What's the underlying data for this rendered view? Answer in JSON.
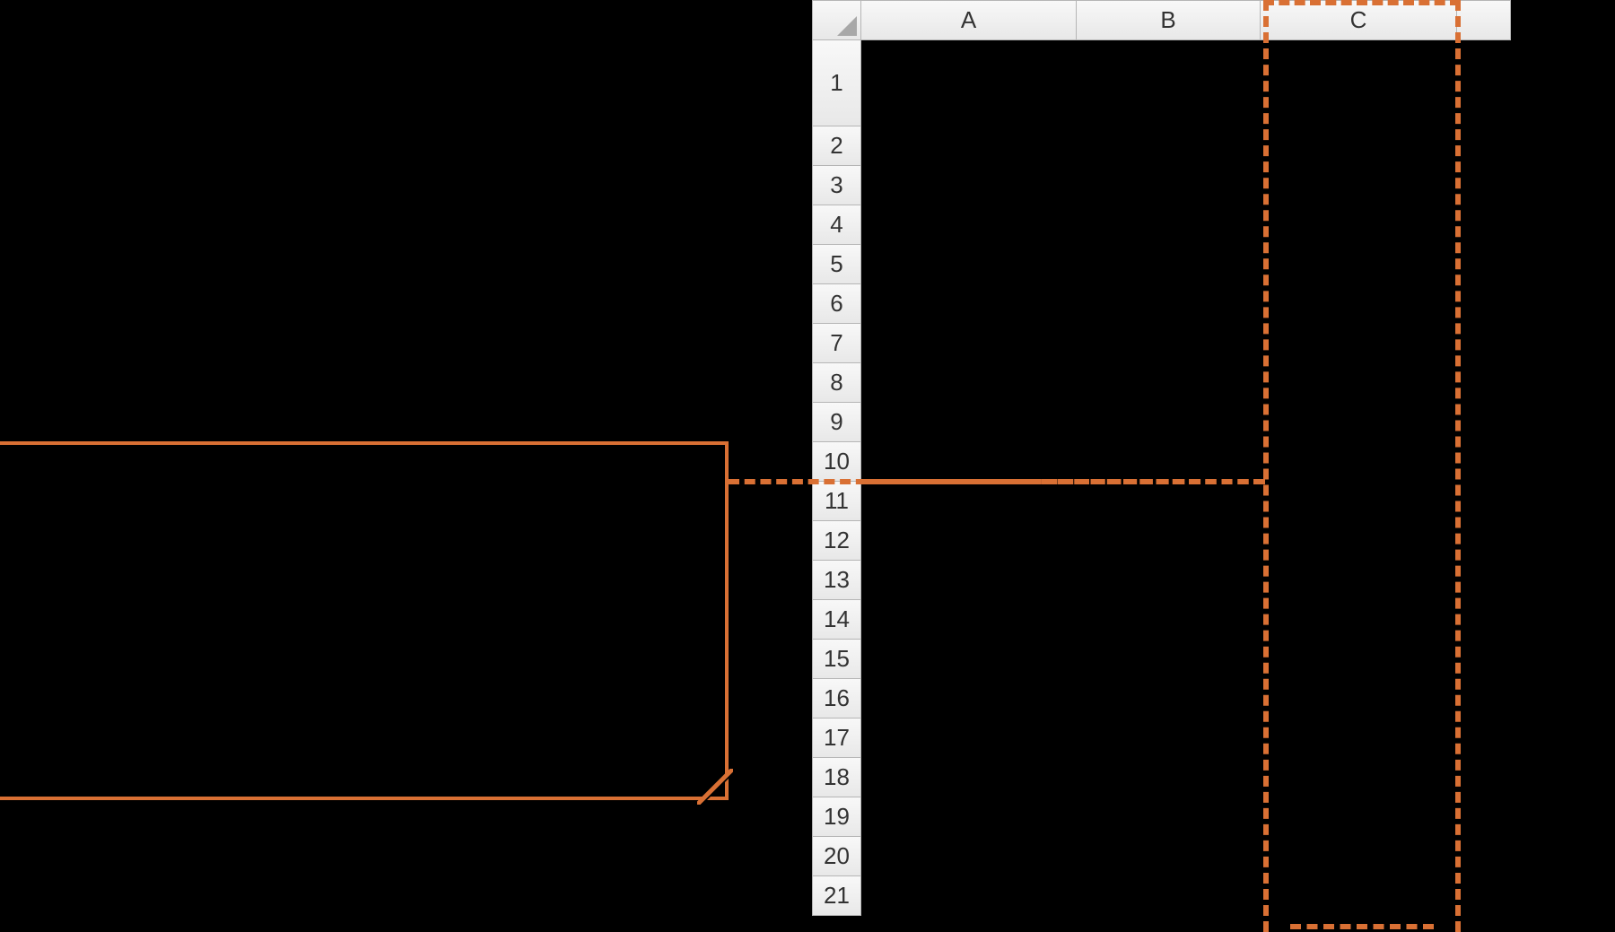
{
  "spreadsheet": {
    "columns": [
      "A",
      "B",
      "C"
    ],
    "row_labels": [
      "1",
      "2",
      "3",
      "4",
      "5",
      "6",
      "7",
      "8",
      "9",
      "10",
      "11",
      "12",
      "13",
      "14",
      "15",
      "16",
      "17",
      "18",
      "19",
      "20",
      "21"
    ]
  },
  "annotations": {
    "callout_label": "",
    "highlight_column": "C",
    "highlight_row": "10"
  }
}
